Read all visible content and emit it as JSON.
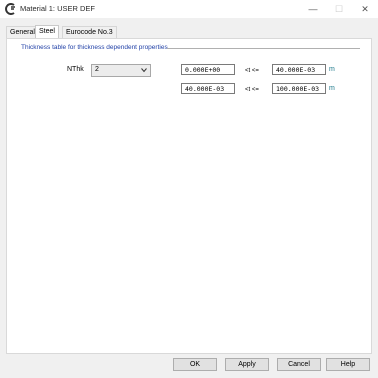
{
  "window": {
    "title": "Material 1: USER DEF"
  },
  "titlebar": {
    "minimize": "—",
    "maximize": "☐",
    "close": "✕"
  },
  "tabs": [
    {
      "label": "General",
      "active": false
    },
    {
      "label": "Steel",
      "active": true
    },
    {
      "label": "Eurocode No.3",
      "active": false
    }
  ],
  "group": {
    "title": "Thickness table for thickness dependent properties"
  },
  "nthk": {
    "label": "NThk",
    "value": "2"
  },
  "rows": [
    {
      "from": "0.000E+00",
      "op": "<t <=",
      "to": "40.000E-03",
      "unit": "m"
    },
    {
      "from": "40.000E-03",
      "op": "<t <=",
      "to": "100.000E-03",
      "unit": "m"
    }
  ],
  "buttons": {
    "ok": "OK",
    "apply": "Apply",
    "cancel": "Cancel",
    "help": "Help"
  },
  "colors": {
    "group_title": "#1f3fa6",
    "unit": "#1f7a8c"
  },
  "icons": {
    "app": "app-logo-icon",
    "dropdown": "chevron-down-icon"
  }
}
